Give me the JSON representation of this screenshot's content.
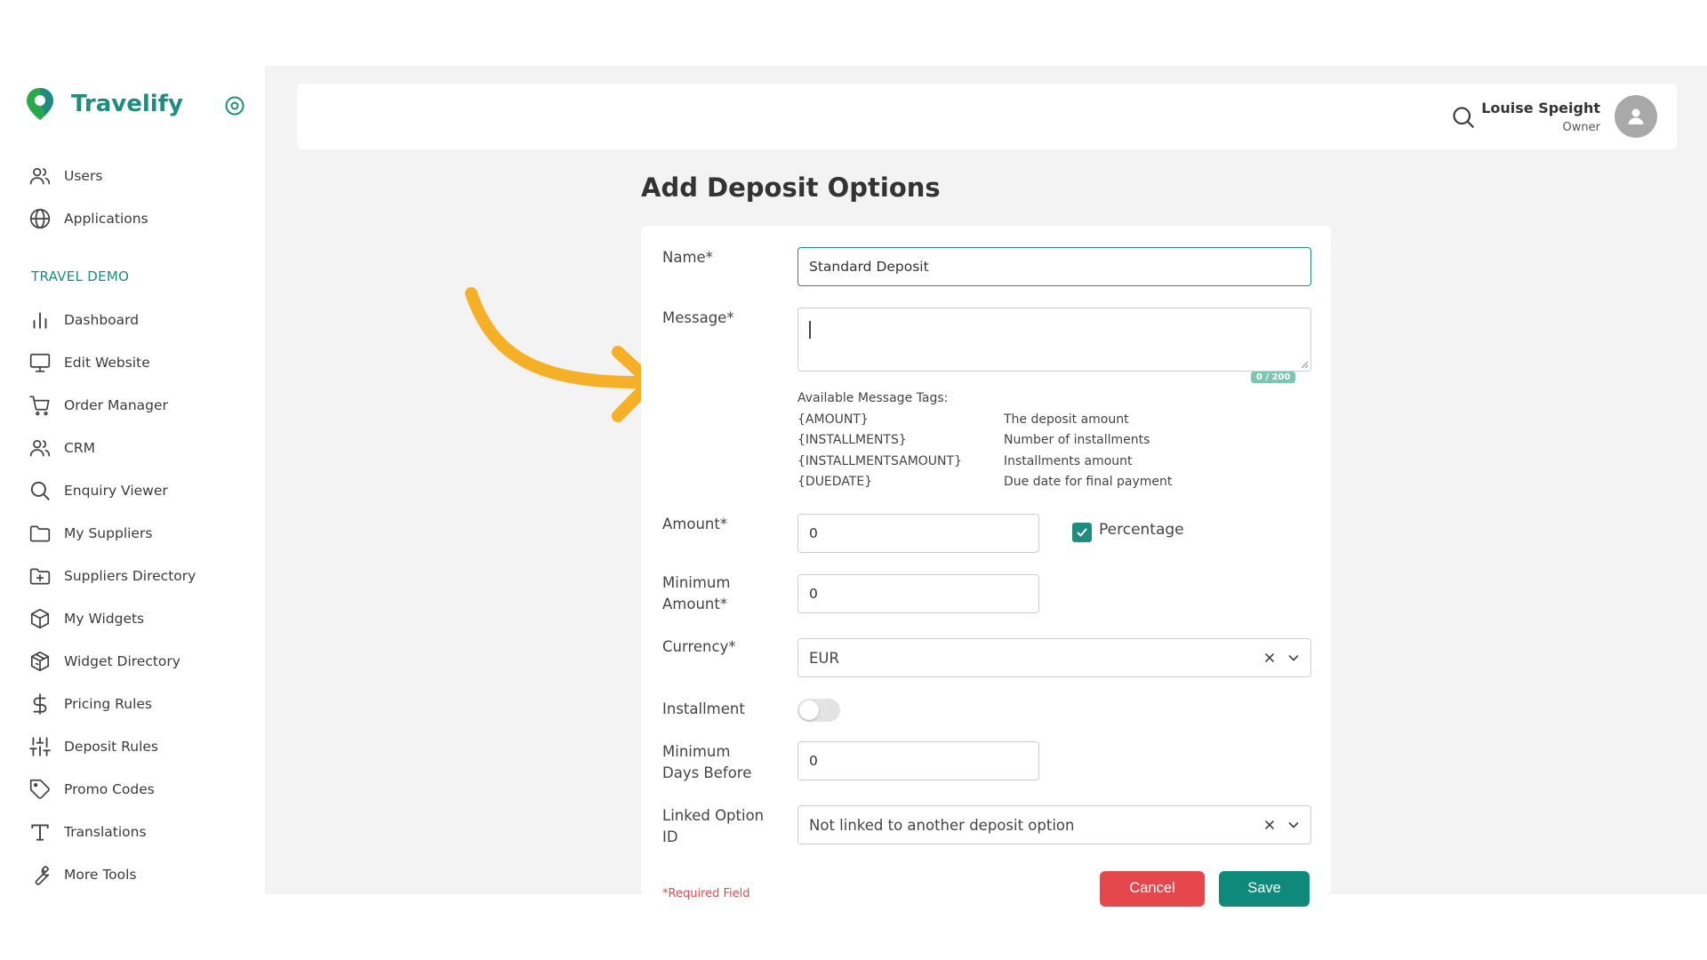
{
  "app": {
    "name": "Travelify"
  },
  "sidebar": {
    "top_items": [
      {
        "label": "Users",
        "icon": "users-icon"
      },
      {
        "label": "Applications",
        "icon": "globe-icon"
      }
    ],
    "section_title": "TRAVEL DEMO",
    "items": [
      {
        "label": "Dashboard",
        "icon": "bar-chart-icon"
      },
      {
        "label": "Edit Website",
        "icon": "monitor-icon"
      },
      {
        "label": "Order Manager",
        "icon": "cart-icon"
      },
      {
        "label": "CRM",
        "icon": "users-icon"
      },
      {
        "label": "Enquiry Viewer",
        "icon": "search-icon"
      },
      {
        "label": "My Suppliers",
        "icon": "folder-icon"
      },
      {
        "label": "Suppliers Directory",
        "icon": "folder-plus-icon"
      },
      {
        "label": "My Widgets",
        "icon": "box-icon"
      },
      {
        "label": "Widget Directory",
        "icon": "boxes-icon"
      },
      {
        "label": "Pricing Rules",
        "icon": "dollar-icon"
      },
      {
        "label": "Deposit Rules",
        "icon": "sliders-icon"
      },
      {
        "label": "Promo Codes",
        "icon": "tag-icon"
      },
      {
        "label": "Translations",
        "icon": "type-icon"
      },
      {
        "label": "More Tools",
        "icon": "wrench-icon"
      }
    ]
  },
  "header": {
    "user_name": "Louise Speight",
    "user_role": "Owner"
  },
  "page": {
    "title": "Add Deposit Options"
  },
  "form": {
    "name_label": "Name*",
    "name_value": "Standard Deposit",
    "message_label": "Message*",
    "message_value": "",
    "message_counter": "0 / 200",
    "tags_title": "Available Message Tags:",
    "tags": [
      {
        "tag": "{AMOUNT}",
        "desc": "The deposit amount"
      },
      {
        "tag": "{INSTALLMENTS}",
        "desc": "Number of installments"
      },
      {
        "tag": "{INSTALLMENTSAMOUNT}",
        "desc": "Installments amount"
      },
      {
        "tag": "{DUEDATE}",
        "desc": "Due date for final payment"
      }
    ],
    "amount_label": "Amount*",
    "amount_value": "0",
    "percentage_label": "Percentage",
    "percentage_checked": true,
    "min_amount_label_1": "Minimum",
    "min_amount_label_2": "Amount*",
    "min_amount_value": "0",
    "currency_label": "Currency*",
    "currency_value": "EUR",
    "installment_label": "Installment",
    "installment_on": false,
    "min_days_label_1": "Minimum",
    "min_days_label_2": "Days Before",
    "min_days_value": "0",
    "linked_label_1": "Linked Option",
    "linked_label_2": "ID",
    "linked_value": "Not linked to another deposit option",
    "cancel_label": "Cancel",
    "save_label": "Save",
    "required_note": "*Required Field"
  },
  "colors": {
    "brand": "#1e8c7e",
    "danger": "#e5474d",
    "arrow": "#f5b027"
  }
}
